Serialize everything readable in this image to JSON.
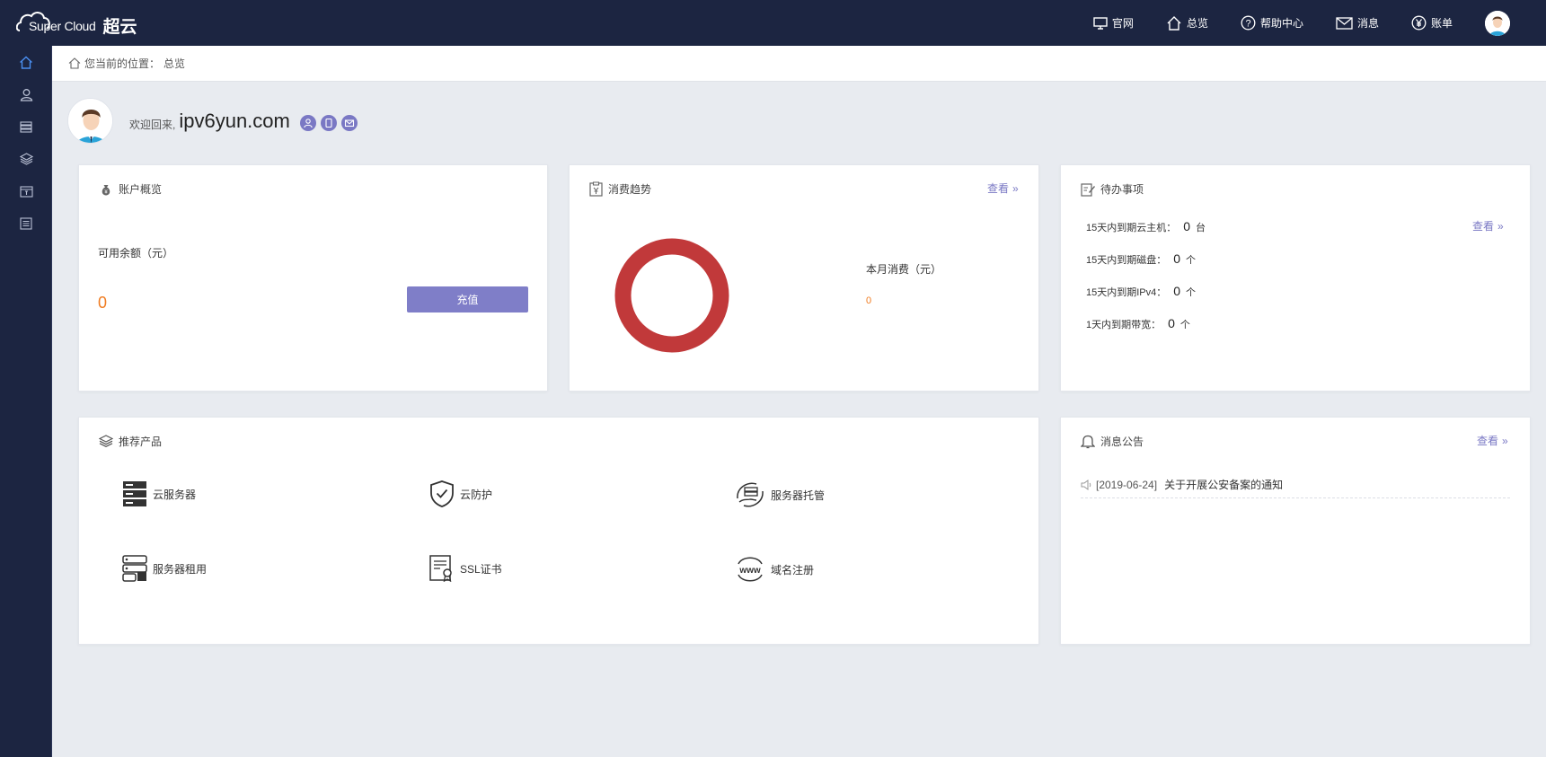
{
  "header": {
    "logo_text": "Super Cloud",
    "logo_cn": "超云",
    "nav": [
      {
        "label": "官网",
        "icon": "monitor-icon"
      },
      {
        "label": "总览",
        "icon": "home-icon"
      },
      {
        "label": "帮助中心",
        "icon": "help-icon"
      },
      {
        "label": "消息",
        "icon": "mail-icon"
      },
      {
        "label": "账单",
        "icon": "yen-icon"
      }
    ]
  },
  "sidebar": {
    "items": [
      {
        "icon": "home-icon",
        "active": true
      },
      {
        "icon": "user-icon"
      },
      {
        "icon": "server-icon"
      },
      {
        "icon": "layers-icon"
      },
      {
        "icon": "box-icon"
      },
      {
        "icon": "list-icon"
      }
    ]
  },
  "breadcrumb": {
    "prefix": "您当前的位置：",
    "current": "总览"
  },
  "welcome": {
    "prefix": "欢迎回来,",
    "username": "ipv6yun.com"
  },
  "account": {
    "title": "账户概览",
    "balance_label": "可用余额（元）",
    "balance_value": "0",
    "recharge_label": "充值"
  },
  "trend": {
    "title": "消费趋势",
    "view_label": "查看",
    "month_label": "本月消费（元）",
    "month_value": "0",
    "ring_color": "#c1393a"
  },
  "todo": {
    "title": "待办事项",
    "view_label": "查看",
    "rows": [
      {
        "label": "15天内到期云主机：",
        "value": "0",
        "unit": "台"
      },
      {
        "label": "15天内到期磁盘：",
        "value": "0",
        "unit": "个"
      },
      {
        "label": "15天内到期IPv4：",
        "value": "0",
        "unit": "个"
      },
      {
        "label": "1天内到期带宽：",
        "value": "0",
        "unit": "个"
      }
    ]
  },
  "products": {
    "title": "推荐产品",
    "items": [
      {
        "label": "云服务器",
        "icon": "server-icon"
      },
      {
        "label": "云防护",
        "icon": "shield-icon"
      },
      {
        "label": "服务器托管",
        "icon": "hosting-icon"
      },
      {
        "label": "服务器租用",
        "icon": "rental-icon"
      },
      {
        "label": "SSL证书",
        "icon": "certificate-icon"
      },
      {
        "label": "域名注册",
        "icon": "www-icon"
      }
    ]
  },
  "notices": {
    "title": "消息公告",
    "view_label": "查看",
    "items": [
      {
        "date": "[2019-06-24]",
        "text": "关于开展公安备案的通知"
      }
    ]
  },
  "colors": {
    "nav_bg": "#1c2541",
    "accent": "#7f7ec8",
    "value_orange": "#f07c21"
  }
}
